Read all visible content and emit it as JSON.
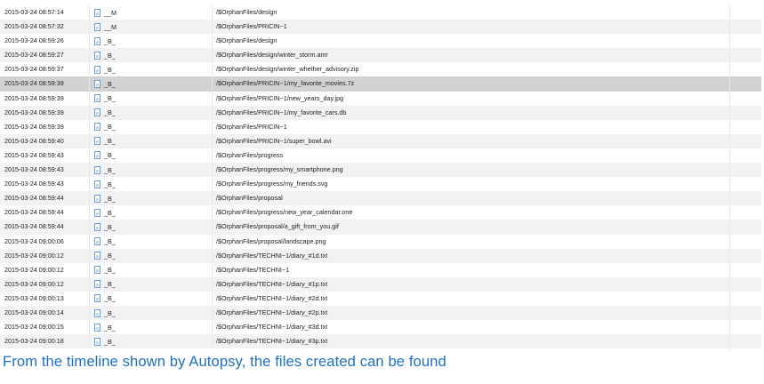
{
  "timeline": {
    "rows": [
      {
        "date": "2015-03-24 08:57:14",
        "flags": "__M",
        "path": "/$OrphanFiles/design"
      },
      {
        "date": "2015-03-24 08:57:32",
        "flags": "__M",
        "path": "/$OrphanFiles/PRICIN~1"
      },
      {
        "date": "2015-03-24 08:59:26",
        "flags": "_B_",
        "path": "/$OrphanFiles/design"
      },
      {
        "date": "2015-03-24 08:59:27",
        "flags": "_B_",
        "path": "/$OrphanFiles/design/winter_storm.amr"
      },
      {
        "date": "2015-03-24 08:59:37",
        "flags": "_B_",
        "path": "/$OrphanFiles/design/winter_whether_advisory.zip"
      },
      {
        "date": "2015-03-24 08:59:39",
        "flags": "_B_",
        "path": "/$OrphanFiles/PRICIN~1/my_favorite_movies.7z",
        "selected": true
      },
      {
        "date": "2015-03-24 08:59:39",
        "flags": "_B_",
        "path": "/$OrphanFiles/PRICIN~1/new_years_day.jpg"
      },
      {
        "date": "2015-03-24 08:59:39",
        "flags": "_B_",
        "path": "/$OrphanFiles/PRICIN~1/my_favorite_cars.db"
      },
      {
        "date": "2015-03-24 08:59:39",
        "flags": "_B_",
        "path": "/$OrphanFiles/PRICIN~1"
      },
      {
        "date": "2015-03-24 08:59:40",
        "flags": "_B_",
        "path": "/$OrphanFiles/PRICIN~1/super_bowl.avi"
      },
      {
        "date": "2015-03-24 08:59:43",
        "flags": "_B_",
        "path": "/$OrphanFiles/progress"
      },
      {
        "date": "2015-03-24 08:59:43",
        "flags": "_B_",
        "path": "/$OrphanFiles/progress/my_smartphone.png"
      },
      {
        "date": "2015-03-24 08:59:43",
        "flags": "_B_",
        "path": "/$OrphanFiles/progress/my_friends.svg"
      },
      {
        "date": "2015-03-24 08:59:44",
        "flags": "_B_",
        "path": "/$OrphanFiles/proposal"
      },
      {
        "date": "2015-03-24 08:59:44",
        "flags": "_B_",
        "path": "/$OrphanFiles/progress/new_year_calendar.one"
      },
      {
        "date": "2015-03-24 08:59:44",
        "flags": "_B_",
        "path": "/$OrphanFiles/proposal/a_gift_from_you.gif"
      },
      {
        "date": "2015-03-24 09:00:06",
        "flags": "_B_",
        "path": "/$OrphanFiles/proposal/landscape.png"
      },
      {
        "date": "2015-03-24 09:00:12",
        "flags": "_B_",
        "path": "/$OrphanFiles/TECHNI~1/diary_#1d.txt"
      },
      {
        "date": "2015-03-24 09:00:12",
        "flags": "_B_",
        "path": "/$OrphanFiles/TECHNI~1"
      },
      {
        "date": "2015-03-24 09:00:12",
        "flags": "_B_",
        "path": "/$OrphanFiles/TECHNI~1/diary_#1p.txt"
      },
      {
        "date": "2015-03-24 09:00:13",
        "flags": "_B_",
        "path": "/$OrphanFiles/TECHNI~1/diary_#2d.txt"
      },
      {
        "date": "2015-03-24 09:00:14",
        "flags": "_B_",
        "path": "/$OrphanFiles/TECHNI~1/diary_#2p.txt"
      },
      {
        "date": "2015-03-24 09:00:15",
        "flags": "_B_",
        "path": "/$OrphanFiles/TECHNI~1/diary_#3d.txt"
      },
      {
        "date": "2015-03-24 09:00:18",
        "flags": "_B_",
        "path": "/$OrphanFiles/TECHNI~1/diary_#3p.txt"
      }
    ],
    "row_icon": "file-icon"
  },
  "caption": "From the timeline shown by Autopsy, the files created can be found",
  "colors": {
    "caption": "#1f6fc2",
    "selected_row": "#d2d2d2",
    "alt_row": "#f2f2f2",
    "icon_border": "#6a9fd6"
  }
}
